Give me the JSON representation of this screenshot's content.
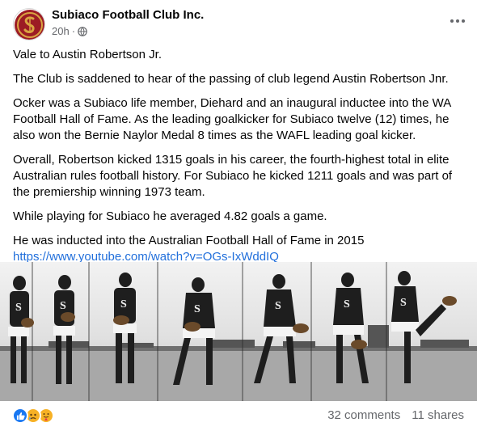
{
  "post": {
    "page_name": "Subiaco Football Club Inc.",
    "time": "20h",
    "separator": "·",
    "privacy_icon": "globe-icon",
    "more_icon": "more-options-icon",
    "paragraphs": [
      "Vale to Austin Robertson Jr.",
      "The Club is saddened to hear of the passing of club legend Austin Robertson Jnr.",
      "Ocker was a Subiaco life member, Diehard and an inaugural inductee into the WA Football Hall of Fame. As the leading goalkicker for Subiaco twelve (12) times, he also won the Bernie Naylor Medal 8 times as the WAFL leading goal kicker.",
      "Overall, Robertson kicked 1315 goals in his career, the fourth-highest total in elite Australian rules football history. For Subiaco he kicked 1211 goals and was part of the premiership winning 1973 team.",
      "While playing for Subiaco he averaged 4.82 goals a game.",
      "He was inducted into the Australian Football Hall of Fame in 2015"
    ],
    "link": "https://www.youtube.com/watch?v=OGs-IxWddIQ",
    "reactions": [
      "like",
      "sad",
      "care"
    ],
    "comments": "32 comments",
    "shares": "11 shares"
  },
  "colors": {
    "link": "#216fdb",
    "secondary_text": "#65676b",
    "logo_red": "#9c1c24",
    "logo_gold": "#d9a441",
    "like": "#1877f2",
    "sad": "#f7b125"
  }
}
